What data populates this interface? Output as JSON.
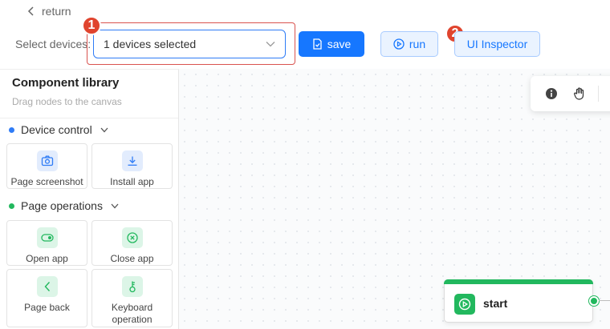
{
  "header": {
    "return_label": "return",
    "devices_label": "Select devices:",
    "device_select_value": "1 devices selected",
    "save_label": "save",
    "run_label": "run",
    "inspector_label": "UI Inspector",
    "badge_1": "1",
    "badge_2": "2"
  },
  "library": {
    "title": "Component library",
    "subtitle": "Drag nodes to the canvas",
    "sections": [
      {
        "label": "Device control",
        "dot_color": "#2f7cf6",
        "items": [
          {
            "label": "Page screenshot",
            "icon": "camera-icon"
          },
          {
            "label": "Install app",
            "icon": "download-icon"
          }
        ]
      },
      {
        "label": "Page operations",
        "dot_color": "#22b85e",
        "items": [
          {
            "label": "Open app",
            "icon": "toggle-icon"
          },
          {
            "label": "Close app",
            "icon": "close-circle-icon"
          },
          {
            "label": "Page back",
            "icon": "chevron-left-icon"
          },
          {
            "label": "Keyboard operation",
            "icon": "key-icon"
          }
        ]
      }
    ]
  },
  "canvas": {
    "start_node_label": "start",
    "toolbar_icons": [
      "info-icon",
      "hand-icon"
    ]
  },
  "colors": {
    "primary": "#1677ff",
    "green": "#22b85e",
    "annotation_red": "#e0442e"
  }
}
